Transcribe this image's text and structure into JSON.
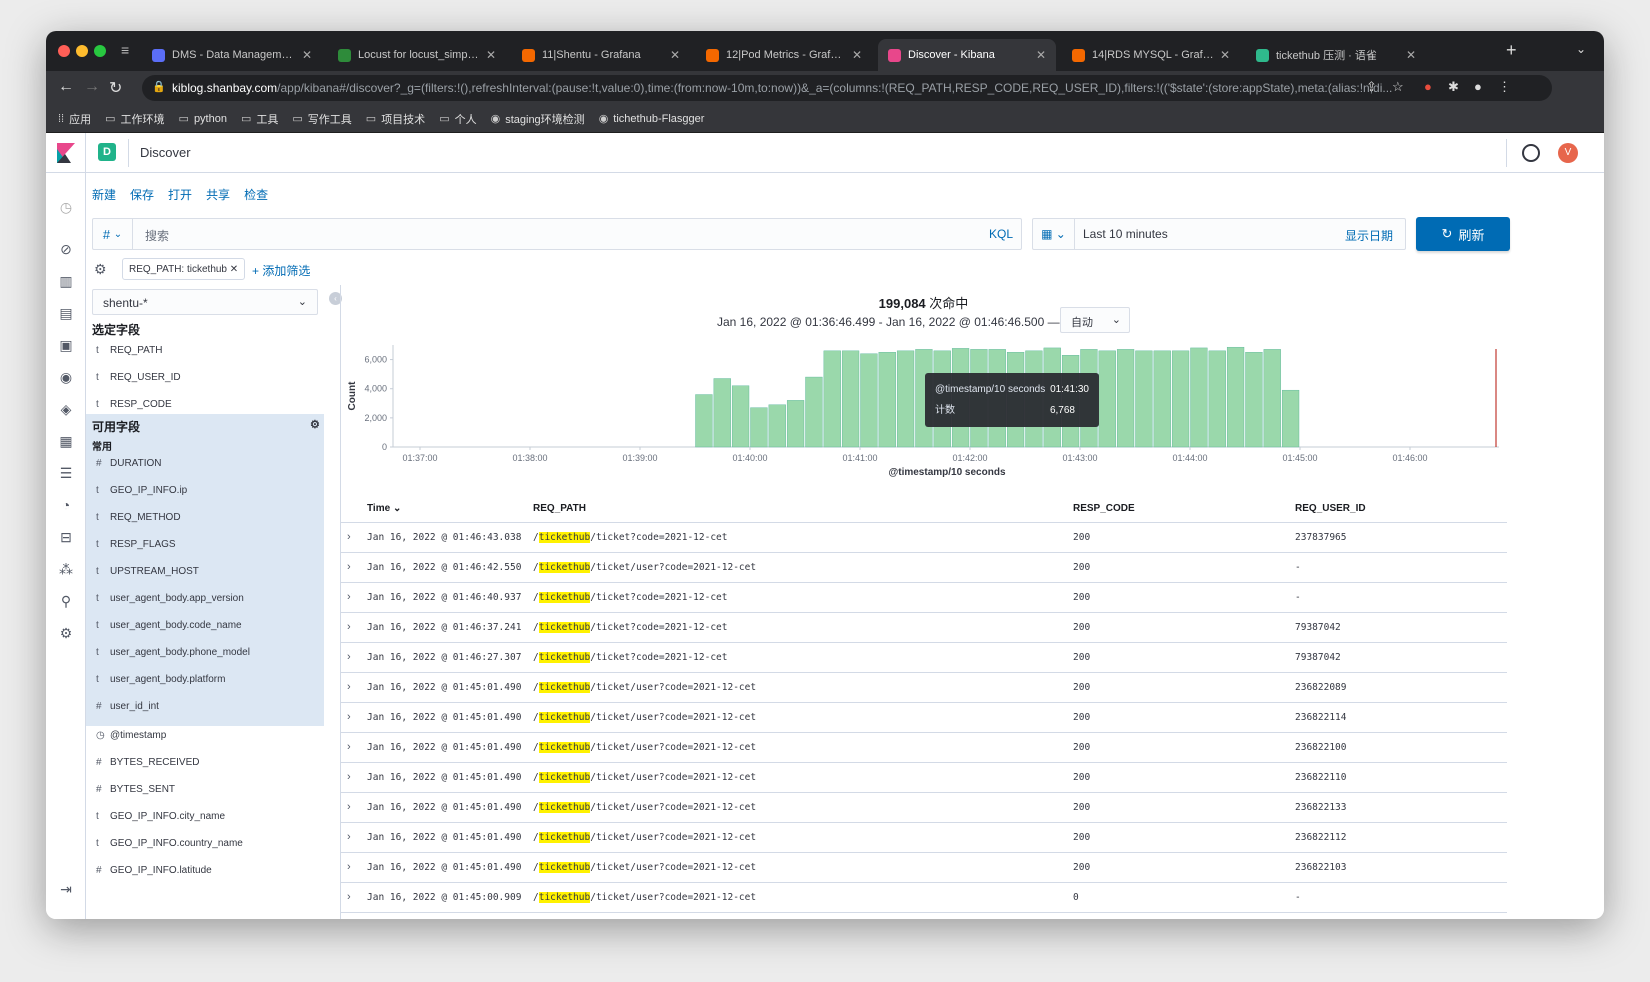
{
  "browser": {
    "tabs": [
      {
        "label": "DMS - Data Management Ser",
        "color": "#5b6ef7"
      },
      {
        "label": "Locust for locust_simple.py",
        "color": "#2e8b3a"
      },
      {
        "label": "11|Shentu - Grafana",
        "color": "#f46800"
      },
      {
        "label": "12|Pod Metrics - Grafana",
        "color": "#f46800"
      },
      {
        "label": "Discover - Kibana",
        "color": "#e8478b"
      },
      {
        "label": "14|RDS MYSQL - Grafana",
        "color": "#f46800"
      },
      {
        "label": "tickethub 压测 · 语雀",
        "color": "#2fb98c"
      }
    ],
    "url_host": "kiblog.shanbay.com",
    "url_path": "/app/kibana#/discover?_g=(filters:!(),refreshInterval:(pause:!t,value:0),time:(from:now-10m,to:now))&_a=(columns:!(REQ_PATH,RESP_CODE,REQ_USER_ID),filters:!(('$state':(store:appState),meta:(alias:!n,di...",
    "bookmarks": [
      "应用",
      "工作环境",
      "python",
      "工具",
      "写作工具",
      "项目技术",
      "个人",
      "staging环境检测",
      "tichethub-Flasgger"
    ]
  },
  "kibana": {
    "space_letter": "D",
    "page_title": "Discover",
    "avatar_letter": "V",
    "menu": [
      "新建",
      "保存",
      "打开",
      "共享",
      "检查"
    ],
    "query": {
      "lang_symbol": "#",
      "placeholder": "搜索",
      "lang": "KQL"
    },
    "date": {
      "range": "Last 10 minutes",
      "show_dates": "显示日期"
    },
    "refresh_label": "刷新",
    "filter": {
      "pill": "REQ_PATH: tickethub",
      "add": "+ 添加筛选"
    },
    "index_pattern": "shentu-*",
    "selected_fields_title": "选定字段",
    "selected_fields": [
      {
        "type": "t",
        "name": "REQ_PATH"
      },
      {
        "type": "t",
        "name": "REQ_USER_ID"
      },
      {
        "type": "t",
        "name": "RESP_CODE"
      }
    ],
    "available_fields_title": "可用字段",
    "common_title": "常用",
    "common_fields": [
      {
        "type": "#",
        "name": "DURATION"
      },
      {
        "type": "t",
        "name": "GEO_IP_INFO.ip"
      },
      {
        "type": "t",
        "name": "REQ_METHOD"
      },
      {
        "type": "t",
        "name": "RESP_FLAGS"
      },
      {
        "type": "t",
        "name": "UPSTREAM_HOST"
      },
      {
        "type": "t",
        "name": "user_agent_body.app_version"
      },
      {
        "type": "t",
        "name": "user_agent_body.code_name"
      },
      {
        "type": "t",
        "name": "user_agent_body.phone_model"
      },
      {
        "type": "t",
        "name": "user_agent_body.platform"
      },
      {
        "type": "#",
        "name": "user_id_int"
      }
    ],
    "other_fields": [
      {
        "type": "◷",
        "name": "@timestamp"
      },
      {
        "type": "#",
        "name": "BYTES_RECEIVED"
      },
      {
        "type": "#",
        "name": "BYTES_SENT"
      },
      {
        "type": "t",
        "name": "GEO_IP_INFO.city_name"
      },
      {
        "type": "t",
        "name": "GEO_IP_INFO.country_name"
      },
      {
        "type": "#",
        "name": "GEO_IP_INFO.latitude"
      }
    ],
    "hits_count": "199,084",
    "hits_suffix": "次命中",
    "time_range_text": "Jan 16, 2022 @ 01:36:46.499 - Jan 16, 2022 @ 01:46:46.500 —",
    "interval": "自动",
    "table": {
      "columns": [
        "Time",
        "REQ_PATH",
        "RESP_CODE",
        "REQ_USER_ID"
      ],
      "sort_indicator": "⌄",
      "rows": [
        {
          "time": "Jan 16, 2022 @ 01:46:43.038",
          "hl": "tickethub",
          "path": "/ticket?code=2021-12-cet",
          "code": "200",
          "uid": "237837965"
        },
        {
          "time": "Jan 16, 2022 @ 01:46:42.550",
          "hl": "tickethub",
          "path": "/ticket/user?code=2021-12-cet",
          "code": "200",
          "uid": "-"
        },
        {
          "time": "Jan 16, 2022 @ 01:46:40.937",
          "hl": "tickethub",
          "path": "/ticket?code=2021-12-cet",
          "code": "200",
          "uid": "-"
        },
        {
          "time": "Jan 16, 2022 @ 01:46:37.241",
          "hl": "tickethub",
          "path": "/ticket?code=2021-12-cet",
          "code": "200",
          "uid": "79387042"
        },
        {
          "time": "Jan 16, 2022 @ 01:46:27.307",
          "hl": "tickethub",
          "path": "/ticket?code=2021-12-cet",
          "code": "200",
          "uid": "79387042"
        },
        {
          "time": "Jan 16, 2022 @ 01:45:01.490",
          "hl": "tickethub",
          "path": "/ticket/user?code=2021-12-cet",
          "code": "200",
          "uid": "236822089"
        },
        {
          "time": "Jan 16, 2022 @ 01:45:01.490",
          "hl": "tickethub",
          "path": "/ticket/user?code=2021-12-cet",
          "code": "200",
          "uid": "236822114"
        },
        {
          "time": "Jan 16, 2022 @ 01:45:01.490",
          "hl": "tickethub",
          "path": "/ticket/user?code=2021-12-cet",
          "code": "200",
          "uid": "236822100"
        },
        {
          "time": "Jan 16, 2022 @ 01:45:01.490",
          "hl": "tickethub",
          "path": "/ticket/user?code=2021-12-cet",
          "code": "200",
          "uid": "236822110"
        },
        {
          "time": "Jan 16, 2022 @ 01:45:01.490",
          "hl": "tickethub",
          "path": "/ticket/user?code=2021-12-cet",
          "code": "200",
          "uid": "236822133"
        },
        {
          "time": "Jan 16, 2022 @ 01:45:01.490",
          "hl": "tickethub",
          "path": "/ticket/user?code=2021-12-cet",
          "code": "200",
          "uid": "236822112"
        },
        {
          "time": "Jan 16, 2022 @ 01:45:01.490",
          "hl": "tickethub",
          "path": "/ticket/user?code=2021-12-cet",
          "code": "200",
          "uid": "236822103"
        },
        {
          "time": "Jan 16, 2022 @ 01:45:00.909",
          "hl": "tickethub",
          "path": "/ticket/user?code=2021-12-cet",
          "code": "0",
          "uid": "-"
        }
      ]
    },
    "colors": {
      "accent": "#006bb4",
      "bar": "#9ad8ab",
      "bar_stroke": "#54b399",
      "highlight": "#fff200"
    }
  },
  "chart_data": {
    "type": "bar",
    "xlabel": "@timestamp/10 seconds",
    "ylabel": "Count",
    "ylim": [
      0,
      7000
    ],
    "yticks": [
      0,
      2000,
      4000,
      6000
    ],
    "ytick_labels": [
      "0",
      "2,000",
      "4,000",
      "6,000"
    ],
    "xtick_labels": [
      "01:37:00",
      "01:38:00",
      "01:39:00",
      "01:40:00",
      "01:41:00",
      "01:42:00",
      "01:43:00",
      "01:44:00",
      "01:45:00",
      "01:46:00"
    ],
    "x_start": "01:37:00",
    "bucket_seconds": 10,
    "first_bucket": "01:39:30",
    "values": [
      3600,
      4700,
      4200,
      2700,
      2900,
      3200,
      4800,
      6600,
      6600,
      6400,
      6500,
      6600,
      6700,
      6600,
      6768,
      6700,
      6700,
      6500,
      6600,
      6800,
      6300,
      6700,
      6600,
      6700,
      6600,
      6600,
      6600,
      6800,
      6600,
      6850,
      6500,
      6700,
      3900
    ],
    "tooltip": {
      "key_label": "@timestamp/10 seconds",
      "key_value": "01:41:30",
      "count_label": "计数",
      "count_value": "6,768"
    }
  }
}
